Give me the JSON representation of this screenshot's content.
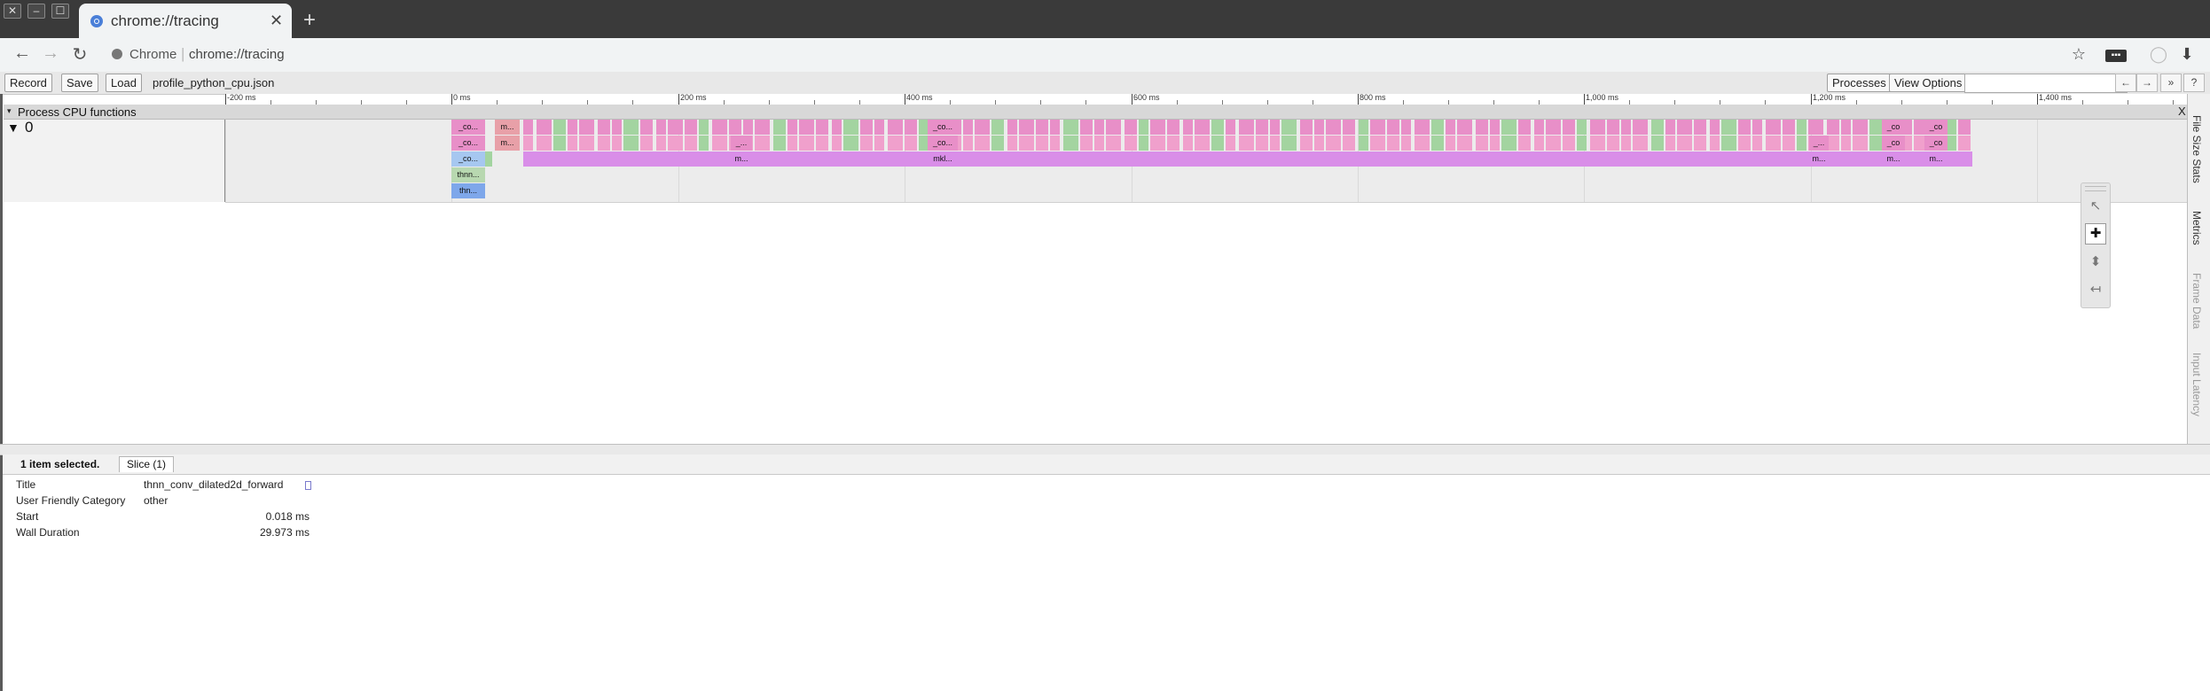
{
  "window": {
    "controls": [
      "✕",
      "–",
      "☐"
    ]
  },
  "tab": {
    "title": "chrome://tracing",
    "close_glyph": "✕",
    "favicon": "chrome-favicon-icon",
    "new_tab_glyph": "+"
  },
  "toolbar": {
    "back_glyph": "←",
    "forward_glyph": "→",
    "reload_glyph": "↻",
    "site_label": "Chrome",
    "separator": "|",
    "url": "chrome://tracing",
    "bookmark_glyph": "☆",
    "extension_glyph": "▪▪▪",
    "profile_glyph": "◯",
    "menu_glyph": "⬇"
  },
  "tracing_controls": {
    "record_label": "Record",
    "save_label": "Save",
    "load_label": "Load",
    "filename": "profile_python_cpu.json",
    "processes_label": "Processes",
    "view_options_label": "View Options",
    "search_placeholder": "",
    "prev_glyph": "←",
    "next_glyph": "→",
    "expand_glyph": "»",
    "help_glyph": "?"
  },
  "ruler": {
    "labels": [
      "-200 ms",
      "0 ms",
      "200 ms",
      "400 ms",
      "600 ms",
      "800 ms",
      "1,000 ms",
      "1,200 ms",
      "1,400 ms"
    ]
  },
  "process": {
    "header_arrow": "▾",
    "title": "Process CPU functions",
    "close_glyph": "X",
    "track_arrow": "▼",
    "track_label": "0"
  },
  "slices": {
    "row0": [
      "_co...",
      "m...",
      "_co",
      "_co"
    ],
    "row1": [
      "_co...",
      "m...",
      "_...",
      "_co...",
      "_...",
      "_co",
      "_co"
    ],
    "row2": [
      "_co...",
      "m...",
      "mkl...",
      "m...",
      "m...",
      "m..."
    ],
    "row3": [
      "thnn..."
    ],
    "row4": [
      "thn..."
    ]
  },
  "side_tabs": {
    "file_size_stats": "File Size Stats",
    "metrics": "Metrics",
    "frame_data": "Frame Data",
    "input_latency": "Input Latency"
  },
  "mouse_tools": {
    "select": "select-tool-icon",
    "pan": "pan-tool-icon",
    "zoom": "zoom-tool-icon",
    "timing": "timing-tool-icon"
  },
  "analysis": {
    "selection_count": "1 item selected.",
    "tab_label": "Slice (1)",
    "rows": {
      "title_key": "Title",
      "title_val": "thnn_conv_dilated2d_forward",
      "category_key": "User Friendly Category",
      "category_val": "other",
      "start_key": "Start",
      "start_val": "0.018 ms",
      "duration_key": "Wall Duration",
      "duration_val": "29.973 ms"
    }
  },
  "colors": {
    "pink": "#e88fc8",
    "light_pink": "#f0a0cc",
    "green": "#a3d4a0",
    "magenta": "#d98ee8",
    "blue": "#7ea7ea",
    "light_blue": "#a6c7f0",
    "teal_green": "#b8d8b0",
    "salmon": "#e8a0a8"
  }
}
